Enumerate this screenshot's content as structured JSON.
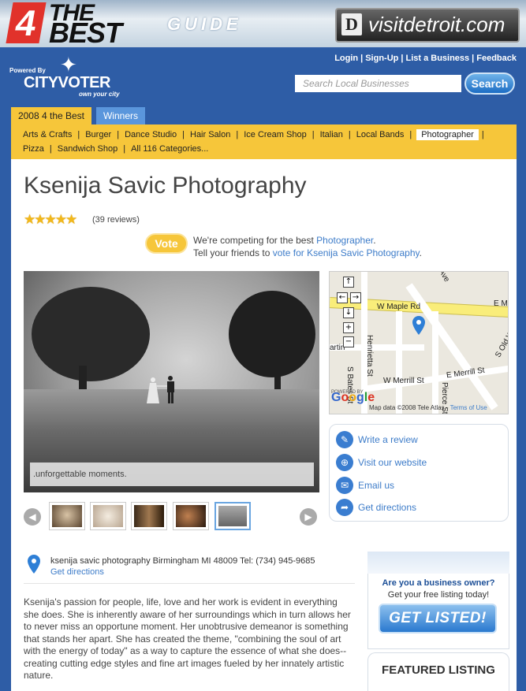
{
  "banner": {
    "number": "4",
    "the": "THE",
    "best": "BEST",
    "guide": "GUIDE",
    "visit_d": "D",
    "visit_text": "visitdetroit.com"
  },
  "header": {
    "powered_by": "Powered By",
    "brand": "CITYVOTER",
    "tagline": "own your city",
    "links": [
      "Login",
      "Sign-Up",
      "List a Business",
      "Feedback"
    ],
    "search_placeholder": "Search Local Businesses",
    "search_button": "Search"
  },
  "tabs": {
    "active": "2008 4 the Best",
    "winners": "Winners"
  },
  "categories": {
    "row1": [
      "Arts & Crafts",
      "Burger",
      "Dance Studio",
      "Hair Salon",
      "Ice Cream Shop",
      "Italian",
      "Local Bands",
      "Photographer"
    ],
    "row2": [
      "Pizza",
      "Sandwich Shop",
      "All 116 Categories..."
    ],
    "selected": "Photographer"
  },
  "business": {
    "name": "Ksenija Savic Photography",
    "rating": 5,
    "stars": "★★★★★",
    "reviews": "(39 reviews)"
  },
  "vote": {
    "badge": "Vote",
    "line1_prefix": "We're competing for the best ",
    "line1_link": "Photographer",
    "line1_suffix": ".",
    "line2_prefix": "Tell your friends to ",
    "line2_link": "vote for Ksenija Savic Photography",
    "line2_suffix": "."
  },
  "gallery": {
    "caption": ".unforgettable moments.",
    "prev": "◀",
    "next": "▶",
    "selected_index": 4
  },
  "map": {
    "roads": {
      "maple": "W Maple Rd",
      "maple_e": "E M",
      "henrietta": "Henrietta St",
      "bates": "S Bates St",
      "merrill_w": "W Merrill St",
      "merrill_e": "E Merrill St",
      "pierce": "Pierce St",
      "old_wood": "S Old Wood",
      "martin": "artin",
      "ave": "Ave"
    },
    "controls": {
      "up": "↑",
      "left": "←",
      "right": "→",
      "down": "↓",
      "zoom_in": "+",
      "zoom_out": "−"
    },
    "powered": "POWERED BY",
    "google": "Google",
    "data_credit": "Map data ©2008 Tele Atlas - ",
    "terms": "Terms of Use"
  },
  "actions": [
    {
      "label": "Write a review",
      "icon": "✎"
    },
    {
      "label": "Visit our website",
      "icon": "⊕"
    },
    {
      "label": "Email us",
      "icon": "✉"
    },
    {
      "label": "Get directions",
      "icon": "➦"
    }
  ],
  "address": {
    "line": "ksenija savic photography Birmingham MI 48009 Tel: (734) 945-9685",
    "directions": "Get directions"
  },
  "description": "Ksenija's passion for people, life, love and her work is evident in everything she does. She is inherently aware of her surroundings which in turn allows her to never miss an opportune moment. Her unobtrusive demeanor is something that stands her apart. She has created the theme, \"combining the soul of art with the energy of today\" as a way to capture the essence of what she does--creating cutting edge styles and fine art images fueled by her innately artistic nature.",
  "owner": {
    "question": "Are you a business owner?",
    "sub": "Get your free listing today!",
    "button": "GET LISTED!"
  },
  "featured": {
    "title": "FEATURED LISTING"
  },
  "colors": {
    "page_bg": "#2e5da6",
    "tab_yellow": "#f6c63a",
    "link_blue": "#3d7cc9",
    "star_gold": "#f2b81b"
  }
}
